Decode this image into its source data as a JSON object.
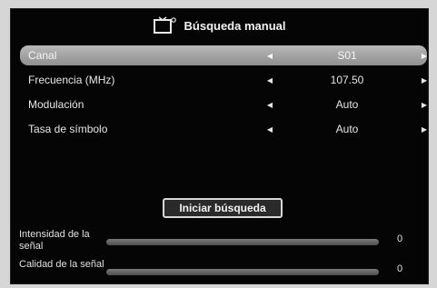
{
  "header": {
    "title": "Búsqueda manual",
    "icon": "tv-search-icon"
  },
  "settings": [
    {
      "label": "Canal",
      "value": "S01",
      "selected": true
    },
    {
      "label": "Frecuencia (MHz)",
      "value": "107.50",
      "selected": false
    },
    {
      "label": "Modulación",
      "value": "Auto",
      "selected": false
    },
    {
      "label": "Tasa de símbolo",
      "value": "Auto",
      "selected": false
    }
  ],
  "start_button": {
    "label": "Iniciar búsqueda"
  },
  "meters": [
    {
      "label": "Intensidad de la señal",
      "value": "0",
      "level": 0
    },
    {
      "label": "Calidad de la señal",
      "value": "0",
      "level": 0
    }
  ],
  "colors": {
    "background": "#050505",
    "selected_row": "#a8a8a8",
    "meter_fill": "#3aa0e0"
  }
}
